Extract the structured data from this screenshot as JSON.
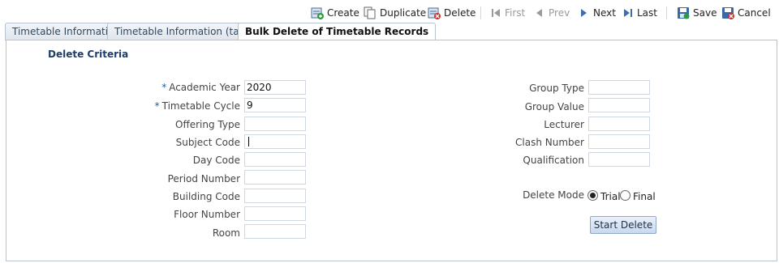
{
  "toolbar": {
    "create": "Create",
    "duplicate": "Duplicate",
    "delete": "Delete",
    "first": "First",
    "prev": "Prev",
    "next": "Next",
    "last": "Last",
    "save": "Save",
    "cancel": "Cancel"
  },
  "tabs": [
    {
      "label": "Timetable Information"
    },
    {
      "label": "Timetable Information (table)"
    },
    {
      "label": "Bulk Delete of Timetable Records"
    }
  ],
  "section_title": "Delete Criteria",
  "left_fields": [
    {
      "label": "Academic Year",
      "required": "*",
      "value": "2020"
    },
    {
      "label": "Timetable Cycle",
      "required": "*",
      "value": "9"
    },
    {
      "label": "Offering Type",
      "value": ""
    },
    {
      "label": "Subject Code",
      "value": ""
    },
    {
      "label": "Day Code",
      "value": ""
    },
    {
      "label": "Period Number",
      "value": ""
    },
    {
      "label": "Building Code",
      "value": ""
    },
    {
      "label": "Floor Number",
      "value": ""
    },
    {
      "label": "Room",
      "value": ""
    }
  ],
  "right_fields": [
    {
      "label": "Group Type",
      "value": ""
    },
    {
      "label": "Group Value",
      "value": ""
    },
    {
      "label": "Lecturer",
      "value": ""
    },
    {
      "label": "Clash Number",
      "value": ""
    },
    {
      "label": "Qualification",
      "value": ""
    }
  ],
  "delete_mode": {
    "label": "Delete Mode",
    "options": [
      "Trial",
      "Final"
    ],
    "selected": "Trial"
  },
  "start_button": "Start Delete",
  "colors": {
    "accent": "#1d3e68",
    "required": "#1d5fa6",
    "tab_border": "#b6c3d3"
  }
}
